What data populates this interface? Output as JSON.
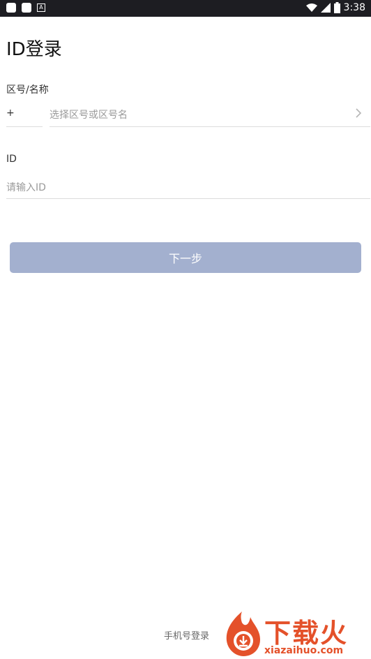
{
  "status_bar": {
    "time": "3:38"
  },
  "page": {
    "title": "ID登录"
  },
  "region": {
    "label": "区号/名称",
    "plus": "+",
    "placeholder": "选择区号或区号名"
  },
  "id_field": {
    "label": "ID",
    "placeholder": "请输入ID"
  },
  "actions": {
    "next_label": "下一步",
    "phone_login_label": "手机号登录"
  },
  "watermark": {
    "brand": "下载火",
    "url": "xiazaihuo.com"
  },
  "colors": {
    "button": "#a3b0cf",
    "watermark": "#e4512a",
    "status_bar": "#1d1d22"
  }
}
